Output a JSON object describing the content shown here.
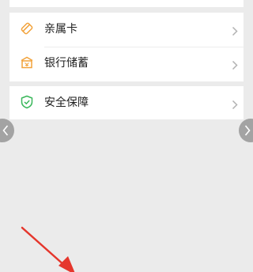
{
  "menu": {
    "items": [
      {
        "label": "亲属卡",
        "icon": "family-card-icon"
      },
      {
        "label": "银行储蓄",
        "icon": "bank-savings-icon"
      },
      {
        "label": "安全保障",
        "icon": "security-shield-icon"
      }
    ]
  },
  "colors": {
    "page_background": "#ebebeb",
    "card_background": "#ffffff",
    "icon_orange": "#f2a23a",
    "icon_green": "#3bb85c",
    "chevron": "#b2b2b2",
    "side_button": "#a3a3a3",
    "annotation_arrow": "#e5362c"
  }
}
